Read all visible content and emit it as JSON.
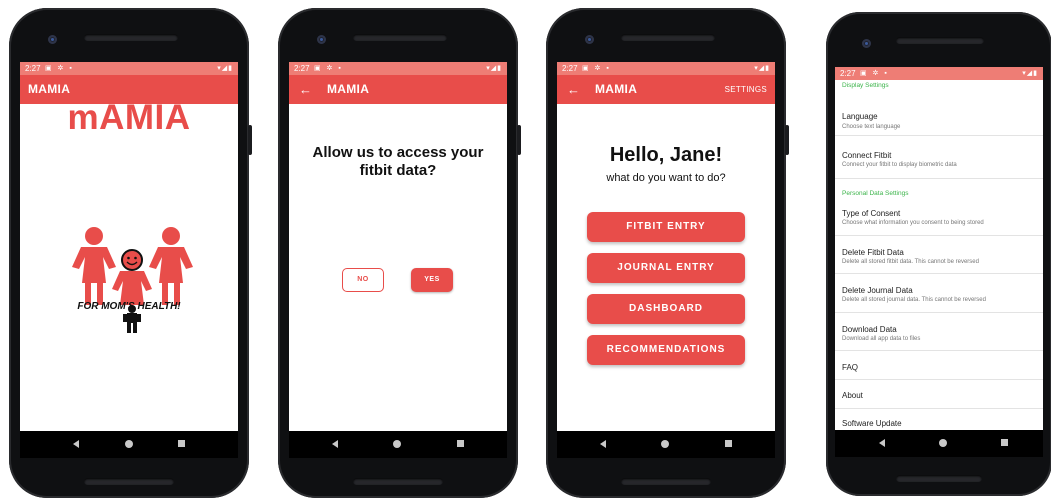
{
  "status": {
    "time": "2:27"
  },
  "app": {
    "title": "MAMIA"
  },
  "splash": {
    "logo_text": "mAMIA",
    "tagline": "FOR MOM'S HEALTH!"
  },
  "consent": {
    "question": "Allow us to access your fitbit data?",
    "no_label": "NO",
    "yes_label": "YES"
  },
  "home": {
    "settings_label": "SETTINGS",
    "greeting": "Hello, Jane!",
    "subtitle": "what do you want to do?",
    "buttons": [
      "FITBIT ENTRY",
      "JOURNAL ENTRY",
      "DASHBOARD",
      "RECOMMENDATIONS"
    ]
  },
  "settings": {
    "display_header": "Display Settings",
    "language": {
      "title": "Language",
      "sub": "Choose text language"
    },
    "connect": {
      "title": "Connect Fitbit",
      "sub": "Connect your fitbit to display biometric data"
    },
    "personal_header": "Personal Data Settings",
    "consent_type": {
      "title": "Type of Consent",
      "sub": "Choose what information you consent to being stored"
    },
    "delete_fitbit": {
      "title": "Delete Fitbit Data",
      "sub": "Delete all stored fitbit data. This cannot be reversed"
    },
    "delete_journal": {
      "title": "Delete Journal Data",
      "sub": "Delete all stored journal data. This cannot be reversed"
    },
    "download": {
      "title": "Download Data",
      "sub": "Download all app data to files"
    },
    "faq": "FAQ",
    "about": "About",
    "update": "Software Update"
  },
  "colors": {
    "brand": "#e84d4a",
    "statusbar": "#ee7d75",
    "section_header": "#3cb44b"
  }
}
